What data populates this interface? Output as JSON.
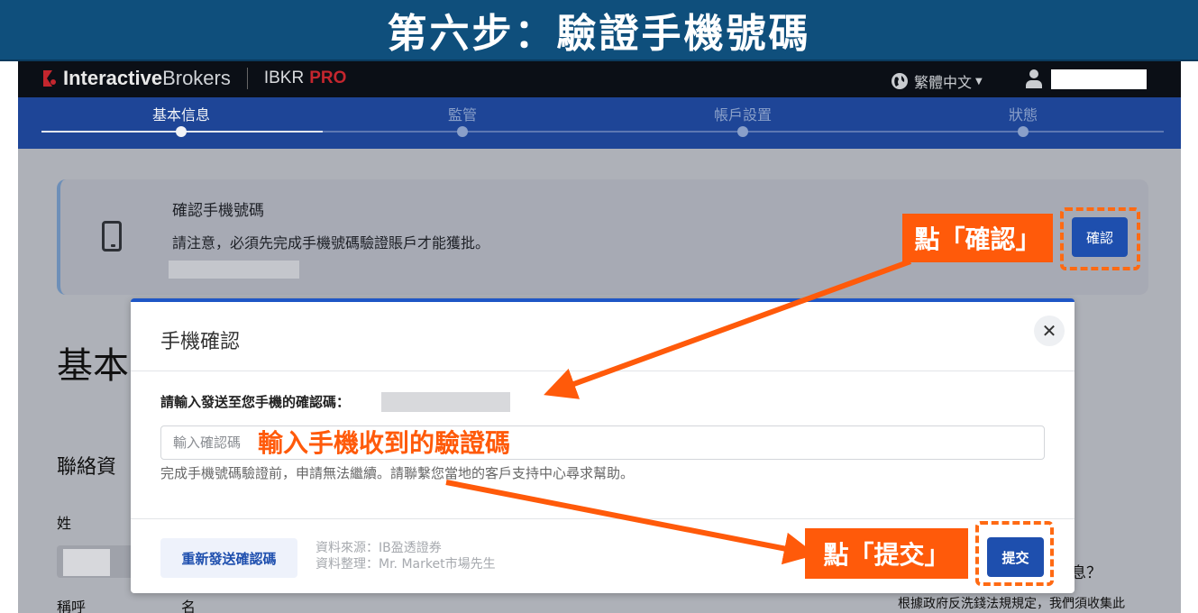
{
  "banner": {
    "title": "第六步：驗證手機號碼"
  },
  "topnav": {
    "brand_bold": "Interactive",
    "brand_regular": "Brokers",
    "product": "IBKR",
    "product_tier": "PRO",
    "language": "繁體中文",
    "icons": [
      "logo-mark",
      "globe-icon",
      "chevron-down-icon",
      "user-icon"
    ]
  },
  "stepper": {
    "steps": [
      {
        "label": "基本信息",
        "active": true
      },
      {
        "label": "監管",
        "active": false
      },
      {
        "label": "帳戶設置",
        "active": false
      },
      {
        "label": "狀態",
        "active": false
      }
    ]
  },
  "verify_card": {
    "title": "確認手機號碼",
    "note": "請注意，必須先完成手機號碼驗證賬戶才能獲批。",
    "button": "確認",
    "icon": "phone-icon"
  },
  "background_page": {
    "heading": "基本",
    "section": "聯絡資",
    "surname_label": "姓",
    "salutation_label": "稱呼",
    "given_name_label": "名",
    "question_fragment": "息？",
    "law_notice": "根據政府反洗錢法規規定，我們須收集此"
  },
  "modal": {
    "title": "手機確認",
    "close": "✕",
    "prompt": "請輸入發送至您手機的確認碼：",
    "input_placeholder": "輸入確認碼",
    "helper": "完成手機號碼驗證前，申請無法繼續。請聯繫您當地的客戶支持中心尋求幫助。",
    "resend_button": "重新發送確認碼",
    "source_line1": "資料來源：IB盈透證券",
    "source_line2": "資料整理：Mr. Market市場先生",
    "submit_button": "提交"
  },
  "annotations": {
    "click_confirm": "點「確認」",
    "enter_code": "輸入手機收到的驗證碼",
    "click_submit": "點「提交」",
    "accent_color": "#ff5a0a"
  }
}
